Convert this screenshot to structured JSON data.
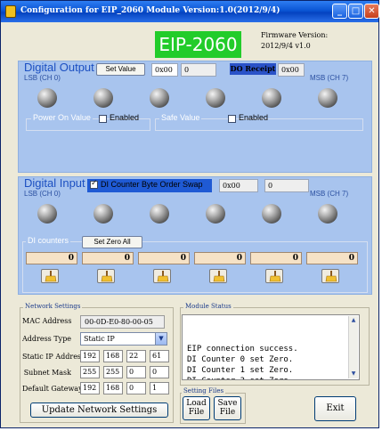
{
  "window": {
    "title": "Configuration for EIP_2060 Module Version:1.0(2012/9/4)"
  },
  "header": {
    "logo_text": "EIP-2060",
    "firmware_label": "Firmware Version:",
    "firmware_value": "2012/9/4 v1.0"
  },
  "digital_output": {
    "title": "Digital Output",
    "set_value_label": "Set Value",
    "hex_value": "0x00",
    "dec_value": "0",
    "do_receipt_label": "DO Receipt",
    "do_receipt_value": "0x00",
    "lsb_label": "LSB (CH 0)",
    "msb_label": "MSB (CH 7)",
    "led_count": 6,
    "power_on_group_label": "Power On Value",
    "power_on_enabled_label": "Enabled",
    "power_on_enabled": false,
    "safe_group_label": "Safe Value",
    "safe_enabled_label": "Enabled",
    "safe_enabled": false
  },
  "digital_input": {
    "title": "Digital Input",
    "swap_label": "DI Counter Byte Order Swap",
    "swap_checked": true,
    "hex_value": "0x00",
    "dec_value": "0",
    "lsb_label": "LSB (CH 0)",
    "msb_label": "MSB (CH 7)",
    "led_count": 6,
    "counters_group_label": "DI counters",
    "set_zero_all_label": "Set Zero All",
    "counters": [
      "0",
      "0",
      "0",
      "0",
      "0",
      "0"
    ]
  },
  "network": {
    "group_label": "Network Settings",
    "mac_label": "MAC Address",
    "mac_value": "00-0D-E0-80-00-05",
    "address_type_label": "Address Type",
    "address_type_value": "Static IP",
    "static_ip_label": "Static IP Address",
    "static_ip": [
      "192",
      "168",
      "22",
      "61"
    ],
    "subnet_label": "Subnet Mask",
    "subnet": [
      "255",
      "255",
      "0",
      "0"
    ],
    "gateway_label": "Default Gateway",
    "gateway": [
      "192",
      "168",
      "0",
      "1"
    ],
    "update_button_label": "Update Network Settings"
  },
  "module_status": {
    "group_label": "Module Status",
    "lines": "EIP connection success.\nDI Counter 0 set Zero.\nDI Counter 1 set Zero.\nDI Counter 3 set Zero.\nDI Counter 4 set Zero."
  },
  "setting_files": {
    "group_label": "Setting Files",
    "load_label_1": "Load",
    "load_label_2": "File",
    "save_label_1": "Save",
    "save_label_2": "File"
  },
  "exit_label": "Exit",
  "colors": {
    "logo_green": "#22cc2a",
    "panel_blue": "#a8c4ee",
    "title_blue": "#1b4fc1",
    "counter_bg": "#f6e2c6"
  }
}
